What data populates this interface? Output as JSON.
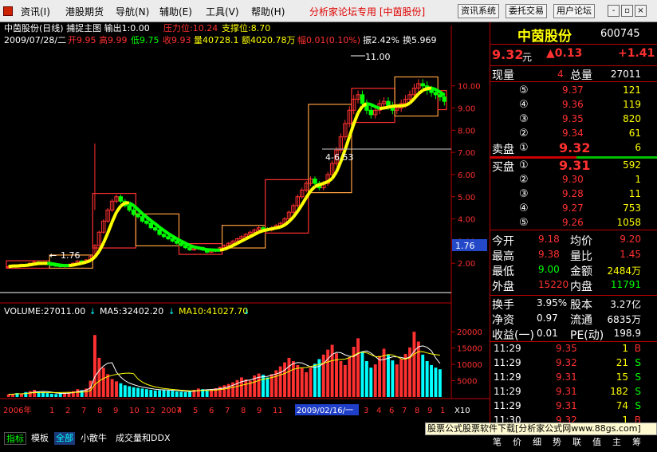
{
  "menubar": {
    "items": [
      "资讯(I)",
      "港股期货",
      "导航(N)",
      "辅助(E)",
      "工具(V)",
      "帮助(H)"
    ],
    "title": "分析家论坛专用 [中茵股份]",
    "buttons": [
      "资讯系统",
      "委托交易",
      "用户论坛"
    ],
    "win_min": "-",
    "win_max": "▫",
    "win_close": "×"
  },
  "chart_header": {
    "line1_name": "中茵股份(日线) 捕捉主图 输出1:0.00",
    "line1_pressure": "压力位:10.24",
    "line1_support": "支撑位:8.70",
    "line2_date": "2009/07/28/二",
    "line2_open": "开9.95",
    "line2_high": "高9.99",
    "line2_low": "低9.75",
    "line2_close": "收9.93",
    "line2_vol": "量40728.1",
    "line2_amt": "额4020.78万",
    "line2_chg": "幅0.01(0.10%)",
    "line2_amp": "振2.42%",
    "line2_turn": "换5.969"
  },
  "price_axis": [
    "10.00",
    "9.00",
    "8.00",
    "7.00",
    "6.00",
    "5.00",
    "4.00",
    "3.00",
    "2.00"
  ],
  "vol_axis": [
    "20000",
    "15000",
    "10000",
    "5000"
  ],
  "vol_header": {
    "vol": "VOLUME:27011.00",
    "ma5": "MA5:32402.20",
    "ma10": "MA10:41027.70"
  },
  "annotations": {
    "high": "11.00",
    "mid": "4-6.53",
    "low": "1.76",
    "low_tag": "1.76",
    "vol_x10": "X10"
  },
  "date_axis": {
    "year": "2006年",
    "ticks": [
      "1",
      "2",
      "7",
      "8",
      "9",
      "10",
      "12",
      "2007",
      "4",
      "5",
      "6",
      "7",
      "8",
      "9",
      "11"
    ],
    "selected": "2009/02/16/一",
    "ticks_after": [
      "3",
      "4",
      "6",
      "7",
      "8",
      "9",
      "1"
    ]
  },
  "stock": {
    "name": "中茵股份",
    "code": "600745",
    "price": "9.32",
    "unit": "元",
    "change": "▲0.13",
    "change_pct": "+1.41"
  },
  "quote": {
    "label_now": "现量",
    "now_vol": "4",
    "label_total": "总量",
    "total_vol": "27011",
    "sell_label": "卖盘",
    "buy_label": "买盘",
    "sells": [
      {
        "idx": "⑤",
        "price": "9.37",
        "vol": "121"
      },
      {
        "idx": "④",
        "price": "9.36",
        "vol": "119"
      },
      {
        "idx": "③",
        "price": "9.35",
        "vol": "820"
      },
      {
        "idx": "②",
        "price": "9.34",
        "vol": "61"
      },
      {
        "idx": "①",
        "price": "9.32",
        "vol": "6"
      }
    ],
    "buys": [
      {
        "idx": "①",
        "price": "9.31",
        "vol": "592"
      },
      {
        "idx": "②",
        "price": "9.30",
        "vol": "1"
      },
      {
        "idx": "③",
        "price": "9.28",
        "vol": "11"
      },
      {
        "idx": "④",
        "price": "9.27",
        "vol": "753"
      },
      {
        "idx": "⑤",
        "price": "9.26",
        "vol": "1058"
      }
    ]
  },
  "stats": [
    {
      "l1": "今开",
      "v1": "9.18",
      "l2": "均价",
      "v2": "9.20"
    },
    {
      "l1": "最高",
      "v1": "9.38",
      "l2": "量比",
      "v2": "1.45"
    },
    {
      "l1": "最低",
      "v1": "9.00",
      "l2": "金额",
      "v2": "2484万"
    },
    {
      "l1": "外盘",
      "v1": "15220",
      "l2": "内盘",
      "v2": "11791"
    }
  ],
  "fin": [
    {
      "l1": "换手",
      "v1": "3.95%",
      "l2": "股本",
      "v2": "3.27亿"
    },
    {
      "l1": "净资",
      "v1": "0.97",
      "l2": "流通",
      "v2": "6835万"
    },
    {
      "l1": "收益(一)",
      "v1": "0.01",
      "l2": "PE(动)",
      "v2": "198.9"
    }
  ],
  "ticks": [
    {
      "t": "11:29",
      "p": "9.35",
      "v": "1",
      "d": "B"
    },
    {
      "t": "11:29",
      "p": "9.32",
      "v": "21",
      "d": "S"
    },
    {
      "t": "11:29",
      "p": "9.31",
      "v": "15",
      "d": "S"
    },
    {
      "t": "11:29",
      "p": "9.31",
      "v": "182",
      "d": "S"
    },
    {
      "t": "11:29",
      "p": "9.31",
      "v": "74",
      "d": "S"
    },
    {
      "t": "11:30",
      "p": "9.32",
      "v": "1",
      "d": "B"
    }
  ],
  "bottom_tabs": [
    "指标",
    "模板",
    "全部",
    "小散牛",
    "成交量和DDX"
  ],
  "side_tabs": [
    "笔",
    "价",
    "细",
    "势",
    "联",
    "值",
    "主",
    "筹"
  ],
  "ad": "股票公式股票软件下载[分析家公式网www.88gs.com]",
  "colors": {
    "red": "#ff3030",
    "green": "#00ff00",
    "yellow": "#ffff00",
    "cyan": "#00ffff",
    "orange": "#ff9f3f",
    "blue": "#3a6cff"
  },
  "chart_data": {
    "type": "candlestick",
    "ylim": [
      1.0,
      11.5
    ],
    "price_ticks": [
      10,
      9,
      8,
      7,
      6,
      5,
      4,
      3,
      2
    ],
    "volume_ticks": [
      20000,
      15000,
      10000,
      5000
    ],
    "marked_high": 11.0,
    "marked_low": 1.76,
    "marked_level": 6.53,
    "pressure": 10.24,
    "support": 8.7,
    "last_close": 9.93,
    "last_volume": 27011.0,
    "volume_ma5": 32402.2,
    "volume_ma10": 41027.7,
    "closes": [
      1.85,
      1.9,
      1.88,
      1.95,
      1.92,
      2.0,
      2.05,
      2.02,
      1.98,
      1.95,
      1.9,
      1.88,
      1.85,
      1.9,
      1.95,
      2.0,
      2.1,
      2.05,
      2.15,
      2.3,
      2.8,
      3.4,
      3.9,
      4.4,
      4.8,
      5.0,
      4.8,
      4.6,
      4.4,
      4.2,
      4.1,
      3.9,
      3.8,
      3.6,
      3.5,
      3.3,
      3.2,
      3.1,
      3.0,
      2.9,
      2.8,
      2.7,
      2.6,
      2.65,
      2.7,
      2.6,
      2.5,
      2.55,
      2.6,
      2.7,
      2.8,
      2.9,
      3.0,
      3.1,
      3.2,
      3.3,
      3.4,
      3.5,
      3.6,
      3.55,
      3.5,
      3.6,
      3.7,
      3.8,
      4.0,
      4.3,
      4.6,
      5.0,
      5.3,
      5.6,
      5.8,
      5.6,
      5.4,
      5.6,
      6.0,
      6.5,
      7.1,
      7.7,
      8.3,
      8.9,
      9.4,
      9.6,
      9.2,
      8.9,
      8.7,
      8.9,
      9.2,
      9.3,
      9.1,
      8.9,
      9.0,
      9.2,
      9.4,
      9.6,
      9.9,
      10.1,
      10.0,
      9.8,
      9.7,
      9.6,
      9.5,
      9.3
    ],
    "volumes": [
      800,
      900,
      1200,
      1000,
      1500,
      1800,
      2200,
      1600,
      1400,
      1200,
      1000,
      900,
      1100,
      1300,
      1600,
      1800,
      2400,
      2100,
      2600,
      5000,
      19000,
      12000,
      9000,
      7000,
      5500,
      4800,
      4200,
      3600,
      3300,
      3000,
      2800,
      2600,
      2400,
      2200,
      2000,
      2100,
      2300,
      2000,
      1900,
      1700,
      1600,
      1500,
      1800,
      2200,
      2600,
      2400,
      2100,
      2300,
      2700,
      3200,
      3600,
      4000,
      4500,
      5200,
      6000,
      5400,
      5000,
      6600,
      7200,
      6800,
      6000,
      7000,
      8200,
      9400,
      10600,
      12000,
      11000,
      9800,
      8800,
      7600,
      9000,
      10200,
      11600,
      13000,
      14500,
      16000,
      13400,
      11000,
      9800,
      12200,
      15400,
      18000,
      14000,
      11000,
      9000,
      10000,
      12600,
      14800,
      13000,
      11200,
      10000,
      11600,
      13200,
      15200,
      20000,
      17000,
      13000,
      11000,
      9800,
      9000,
      8500
    ]
  }
}
